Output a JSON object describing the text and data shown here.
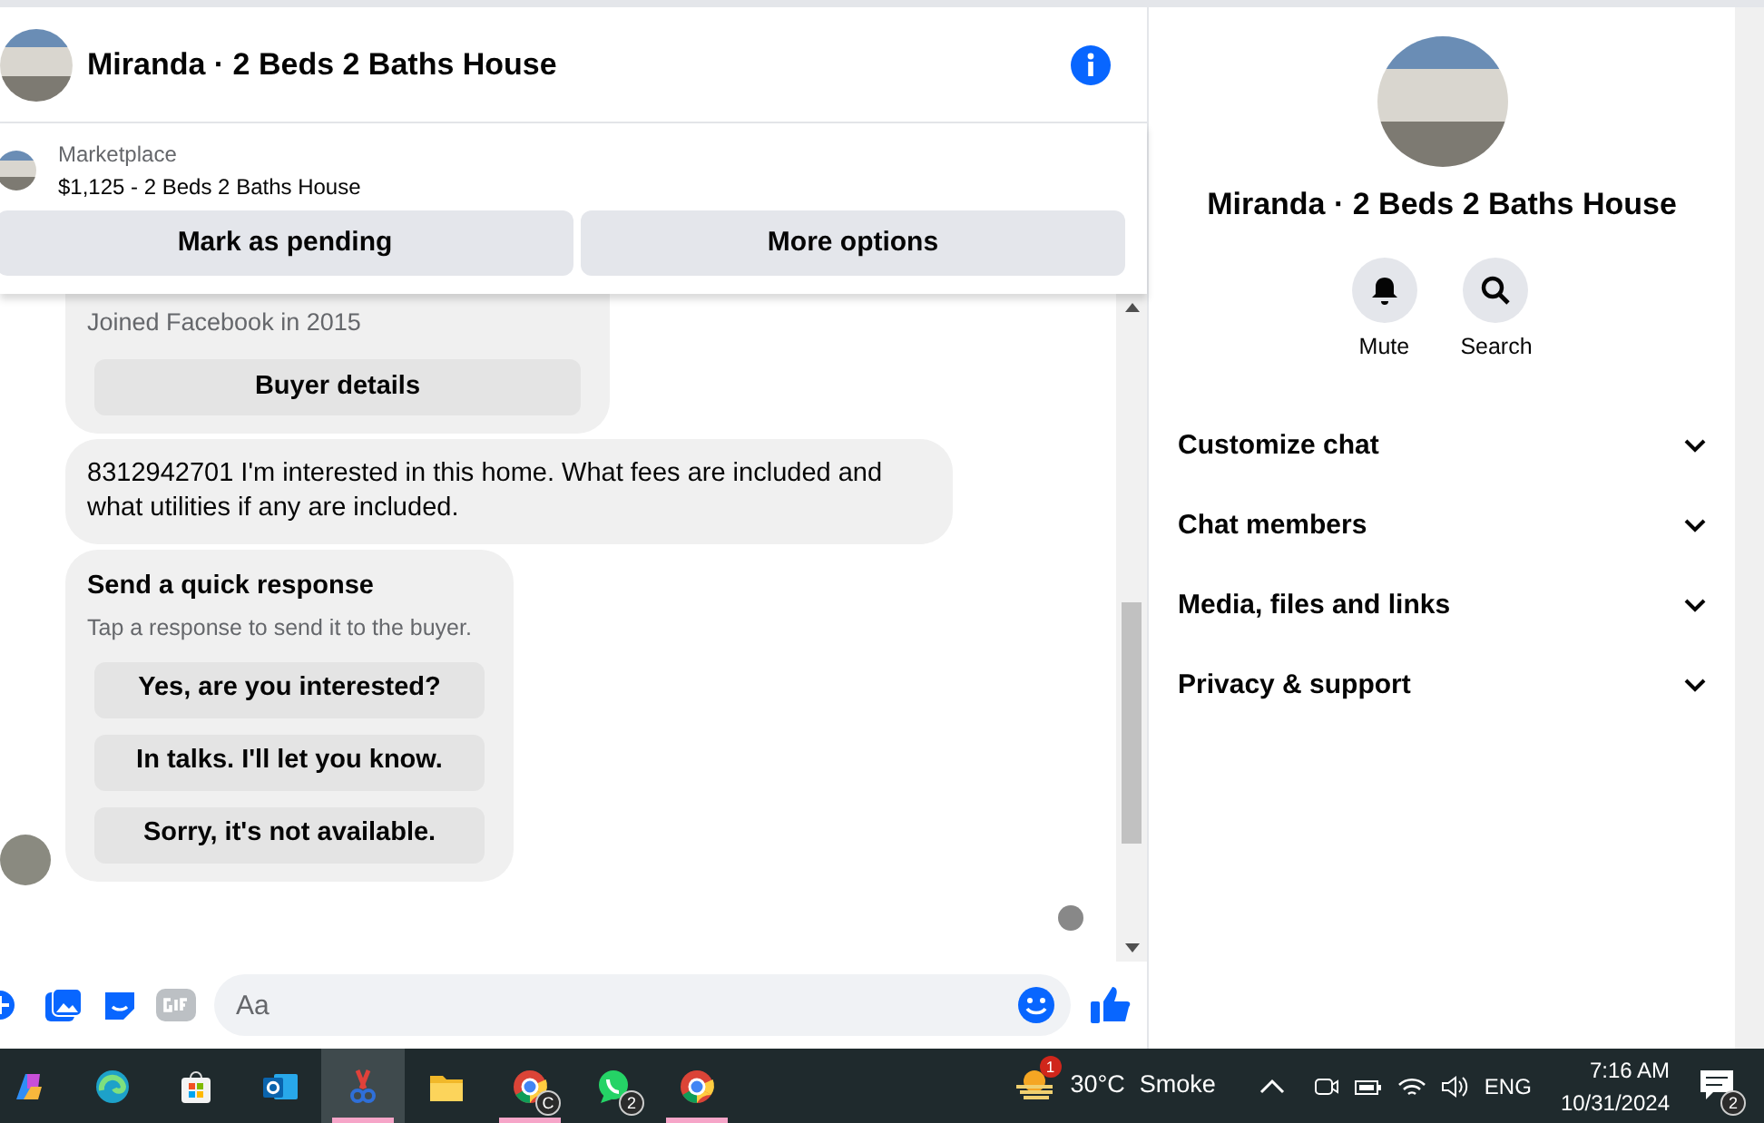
{
  "header": {
    "title": "Miranda · 2 Beds 2 Baths House"
  },
  "listing": {
    "label": "Marketplace",
    "title": "$1,125 - 2 Beds 2 Baths House"
  },
  "listing_actions": [
    "Mark as pending",
    "More options"
  ],
  "messages": [
    {
      "kind": "card",
      "lines": [
        "Joined Facebook in 2015"
      ],
      "button": "Buyer details"
    },
    {
      "kind": "text",
      "text": "8312942701 I'm interested in this home. What fees are included and what utilities if any are included."
    },
    {
      "kind": "quick",
      "title": "Send a quick response",
      "subtitle": "Tap a response to send it to the buyer.",
      "options": [
        "Yes, are you interested?",
        "In talks. I'll let you know.",
        "Sorry, it's not available."
      ]
    }
  ],
  "composer": {
    "placeholder": "Aa"
  },
  "details": {
    "title": "Miranda · 2 Beds 2 Baths House",
    "actions": [
      {
        "label": "Mute",
        "kind": "bell"
      },
      {
        "label": "Search",
        "kind": "search"
      }
    ],
    "sections": [
      {
        "label": "Customize chat",
        "expanded": false
      },
      {
        "label": "Chat members",
        "expanded": false
      },
      {
        "label": "Media, files and links",
        "expanded": false
      },
      {
        "label": "Privacy & support",
        "expanded": false
      }
    ]
  },
  "taskbar": {
    "apps": [
      {
        "kind": "copilot",
        "running": false,
        "selected": false
      },
      {
        "kind": "edge",
        "running": false,
        "selected": false
      },
      {
        "kind": "store",
        "running": false,
        "selected": false
      },
      {
        "kind": "outlook",
        "running": false,
        "selected": false
      },
      {
        "kind": "snip",
        "running": true,
        "selected": true
      },
      {
        "kind": "folder",
        "running": false,
        "selected": false
      },
      {
        "kind": "chrome",
        "running": true,
        "selected": false,
        "badge": "C"
      },
      {
        "kind": "whatsapp",
        "running": false,
        "selected": false,
        "badge": "2"
      },
      {
        "kind": "chrome",
        "running": true,
        "selected": false
      }
    ],
    "weather": {
      "badge": "1",
      "temp": "30°C",
      "condition": "Smoke"
    },
    "language": "ENG",
    "time": "7:16 AM",
    "date": "10/31/2024",
    "notifications": "2"
  }
}
